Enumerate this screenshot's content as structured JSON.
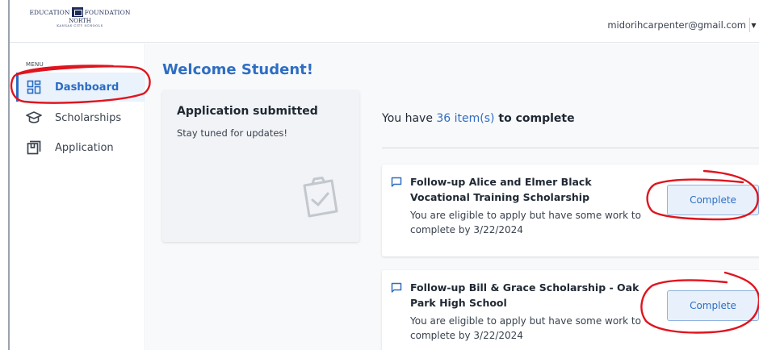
{
  "header": {
    "logo": {
      "left_text": "EDUCATION",
      "right_text": "FOUNDATION",
      "subtitle": "NORTH",
      "tiny_text": "KANSAS CITY SCHOOLS"
    },
    "user_email": "midorihcarpenter@gmail.com"
  },
  "sidebar": {
    "menu_label": "MENU",
    "items": [
      {
        "label": "Dashboard",
        "icon": "dashboard-icon",
        "active": true
      },
      {
        "label": "Scholarships",
        "icon": "graduation-cap-icon",
        "active": false
      },
      {
        "label": "Application",
        "icon": "application-icon",
        "active": false
      }
    ]
  },
  "main": {
    "welcome": "Welcome Student!",
    "status_card": {
      "title": "Application submitted",
      "subtitle": "Stay tuned for updates!",
      "icon": "clipboard-check-icon"
    },
    "todo": {
      "prefix": "You have ",
      "count": "36 item(s)",
      "suffix": " to complete"
    },
    "tasks": [
      {
        "title": "Follow-up Alice and Elmer Black Vocational Training Scholarship",
        "description": "You are eligible to apply but have some work to complete by 3/22/2024",
        "button_label": "Complete",
        "icon": "message-icon"
      },
      {
        "title": "Follow-up Bill & Grace Scholarship - Oak Park High School",
        "description": "You are eligible to apply but have some work to complete by 3/22/2024",
        "button_label": "Complete",
        "icon": "message-icon"
      }
    ]
  },
  "colors": {
    "accent": "#2f6ec2",
    "active_bg": "#eaf2fb",
    "annotation": "#e0141e"
  }
}
